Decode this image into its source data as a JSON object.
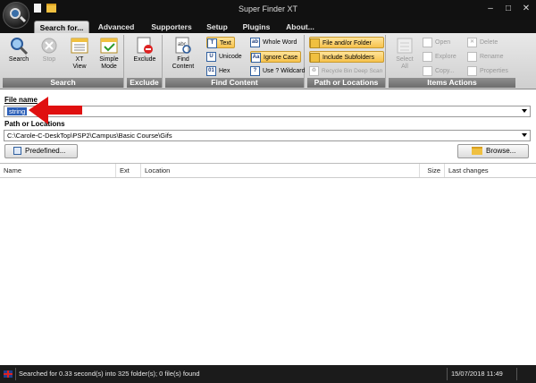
{
  "window": {
    "title": "Super Finder XT",
    "min": "–",
    "max": "□",
    "close": "✕"
  },
  "tabs": [
    {
      "label": "Search for...",
      "active": true
    },
    {
      "label": "Advanced"
    },
    {
      "label": "Supporters"
    },
    {
      "label": "Setup"
    },
    {
      "label": "Plugins"
    },
    {
      "label": "About..."
    }
  ],
  "ribbon": {
    "search_group": {
      "label": "Search",
      "buttons": [
        {
          "label": "Search",
          "icon": "magnifier-icon"
        },
        {
          "label": "Stop",
          "icon": "stop-icon",
          "disabled": true
        },
        {
          "label1": "XT",
          "label2": "View",
          "icon": "xt-view-icon"
        },
        {
          "label1": "Simple",
          "label2": "Mode",
          "icon": "simple-mode-icon"
        }
      ]
    },
    "exclude_group": {
      "label": "Exclude",
      "button": "Exclude"
    },
    "content_group": {
      "label": "Find Content",
      "button1": "Find",
      "button2": "Content",
      "options": [
        "Text",
        "Unicode",
        "Hex",
        "Whole Word",
        "Ignore Case",
        "Use ? Wildcard"
      ]
    },
    "path_group": {
      "label": "Path or Locations",
      "options": [
        "File and/or Folder",
        "Include Subfolders",
        "Recycle Bin Deep Scan"
      ]
    },
    "items_group": {
      "label": "Items Actions",
      "select1": "Select",
      "select2": "All",
      "actions": [
        "Open",
        "Explore",
        "Copy...",
        "Delete",
        "Rename",
        "Properties"
      ]
    }
  },
  "form": {
    "file_name_label": "File name",
    "file_name_value": "string",
    "path_label": "Path or Locations",
    "path_value": "C:\\Carole-C-DeskTop\\PSP2\\Campus\\Basic Course\\Gifs",
    "predefined_button": "Predefined...",
    "browse_button": "Browse..."
  },
  "results": {
    "columns": [
      "Name",
      "Ext",
      "Location",
      "Size",
      "Last changes"
    ]
  },
  "status": {
    "message": "Searched for 0.33 second(s) into 325 folder(s); 0 file(s) found",
    "datetime": "15/07/2018 11:49"
  },
  "colors": {
    "accent_selected": "#f7c24c",
    "annotation_arrow": "#e01010",
    "selection": "#2c5fb8"
  }
}
